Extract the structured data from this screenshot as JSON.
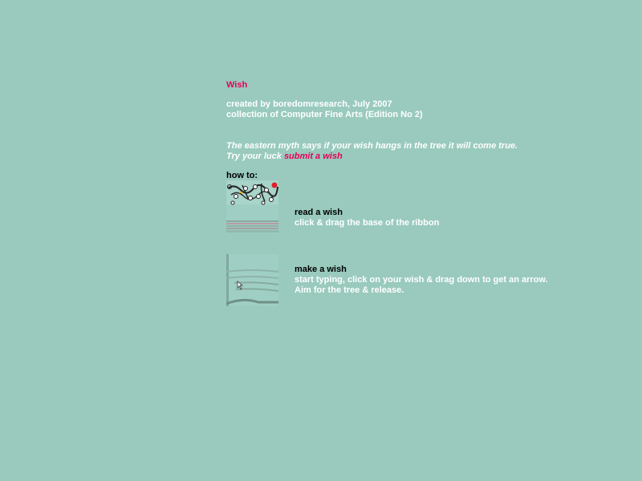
{
  "page": {
    "title": "Wish",
    "credits": {
      "line1": "created by boredomresearch, July 2007",
      "line2": "collection of Computer Fine Arts (Edition No 2)"
    },
    "myth": {
      "line1": "The eastern myth says if your wish hangs in the tree it will come true.",
      "line2_prefix": "Try your luck ",
      "submit_link": "submit a wish"
    },
    "howto_label": "how to:",
    "steps": [
      {
        "heading": "read a wish",
        "lines": [
          "click & drag the base of the ribbon"
        ],
        "thumbnail_icon": "tree-ribbon-thumbnail"
      },
      {
        "heading": "make a wish",
        "lines": [
          "start typing, click on your wish & drag down to get an arrow.",
          "Aim for the tree & release."
        ],
        "thumbnail_icon": "arrow-cursor-thumbnail"
      }
    ]
  },
  "colors": {
    "background": "#99cabd",
    "accent": "#e8005a",
    "text": "#ffffff",
    "heading": "#000000"
  }
}
